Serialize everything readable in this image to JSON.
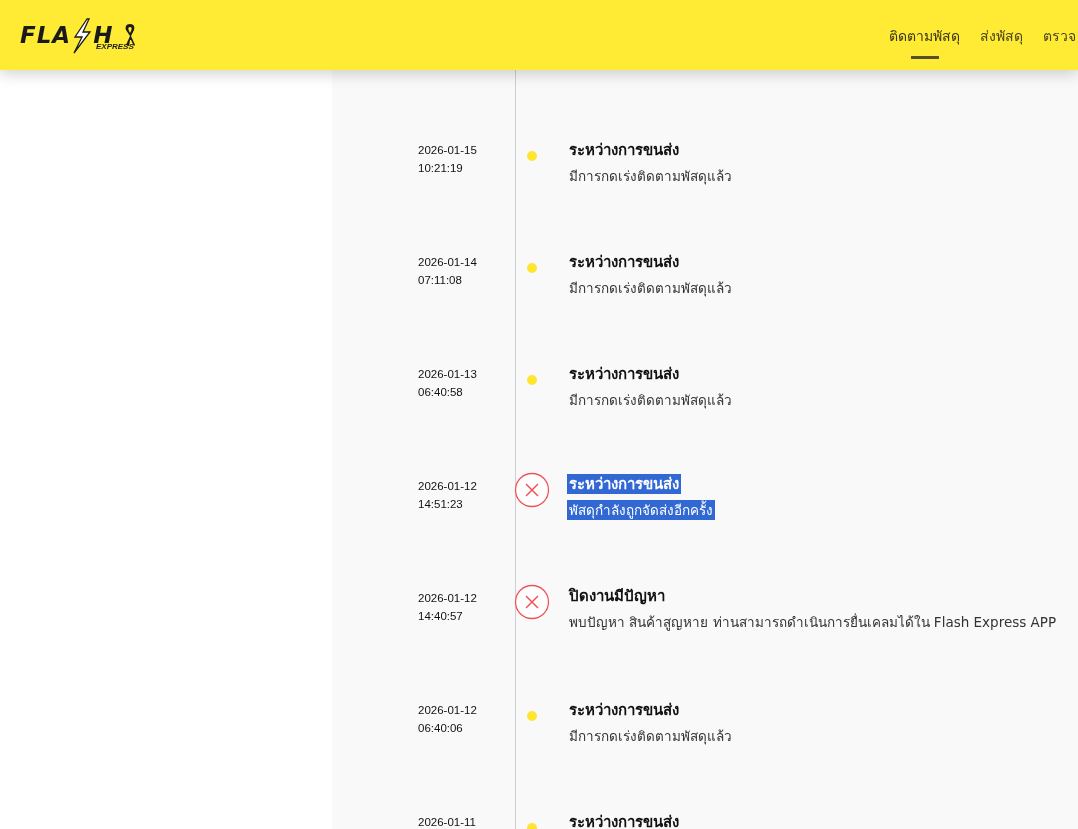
{
  "header": {
    "logo": {
      "left": "FLA",
      "right": "H",
      "sub": "EXPRESS"
    },
    "nav": [
      {
        "label": "ติดตามพัสดุ",
        "selected": true
      },
      {
        "label": "ส่งพัสดุ",
        "selected": false
      },
      {
        "label": "ตรวจ",
        "selected": false
      }
    ]
  },
  "timeline": [
    {
      "kind": "dot",
      "date": "2026-01-15",
      "time": "10:21:19",
      "title": "ระหว่างการขนส่ง",
      "description": "มีการกดเร่งติดตามพัสดุแล้ว",
      "highlighted": false
    },
    {
      "kind": "dot",
      "date": "2026-01-14",
      "time": "07:11:08",
      "title": "ระหว่างการขนส่ง",
      "description": "มีการกดเร่งติดตามพัสดุแล้ว",
      "highlighted": false
    },
    {
      "kind": "dot",
      "date": "2026-01-13",
      "time": "06:40:58",
      "title": "ระหว่างการขนส่ง",
      "description": "มีการกดเร่งติดตามพัสดุแล้ว",
      "highlighted": false
    },
    {
      "kind": "error",
      "date": "2026-01-12",
      "time": "14:51:23",
      "title": "ระหว่างการขนส่ง",
      "description": "พัสดุกำลังถูกจัดส่งอีกครั้ง",
      "highlighted": true
    },
    {
      "kind": "error",
      "date": "2026-01-12",
      "time": "14:40:57",
      "title": "ปิดงานมีปัญหา",
      "description": "พบปัญหา สินค้าสูญหาย ท่านสามารถดำเนินการยื่นเคลมได้ใน Flash Express APP",
      "highlighted": false
    },
    {
      "kind": "dot",
      "date": "2026-01-12",
      "time": "06:40:06",
      "title": "ระหว่างการขนส่ง",
      "description": "มีการกดเร่งติดตามพัสดุแล้ว",
      "highlighted": false
    },
    {
      "kind": "dot",
      "date": "2026-01-11",
      "title": "ระหว่างการขนส่ง",
      "highlighted": false
    }
  ]
}
